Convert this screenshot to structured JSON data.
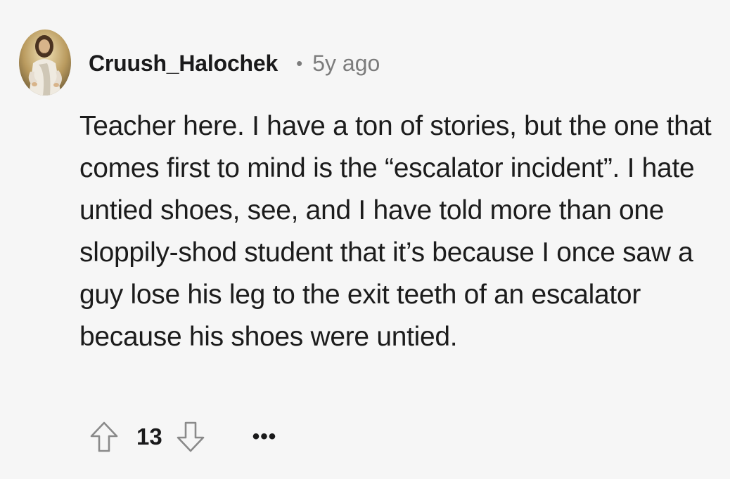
{
  "comment": {
    "author": "Cruush_Halochek",
    "separator": "•",
    "timestamp": "5y ago",
    "avatar_icon": "user-avatar-portrait",
    "body": "Teacher here. I have a ton of stories, but the one that comes first to mind is the “escalator incident”. I hate untied shoes, see, and I have told more than one sloppily-shod student that it’s because I once saw a guy lose his leg to the exit teeth of an escalator because his shoes were untied.",
    "score": "13",
    "more_label": "•••"
  },
  "icons": {
    "upvote": "arrow-up-outline-icon",
    "downvote": "arrow-down-outline-icon",
    "more": "ellipsis-icon"
  },
  "colors": {
    "background": "#f6f6f6",
    "text_primary": "#1a1a1b",
    "text_secondary": "#7c7c7c",
    "icon_stroke": "#8a8a8a"
  }
}
